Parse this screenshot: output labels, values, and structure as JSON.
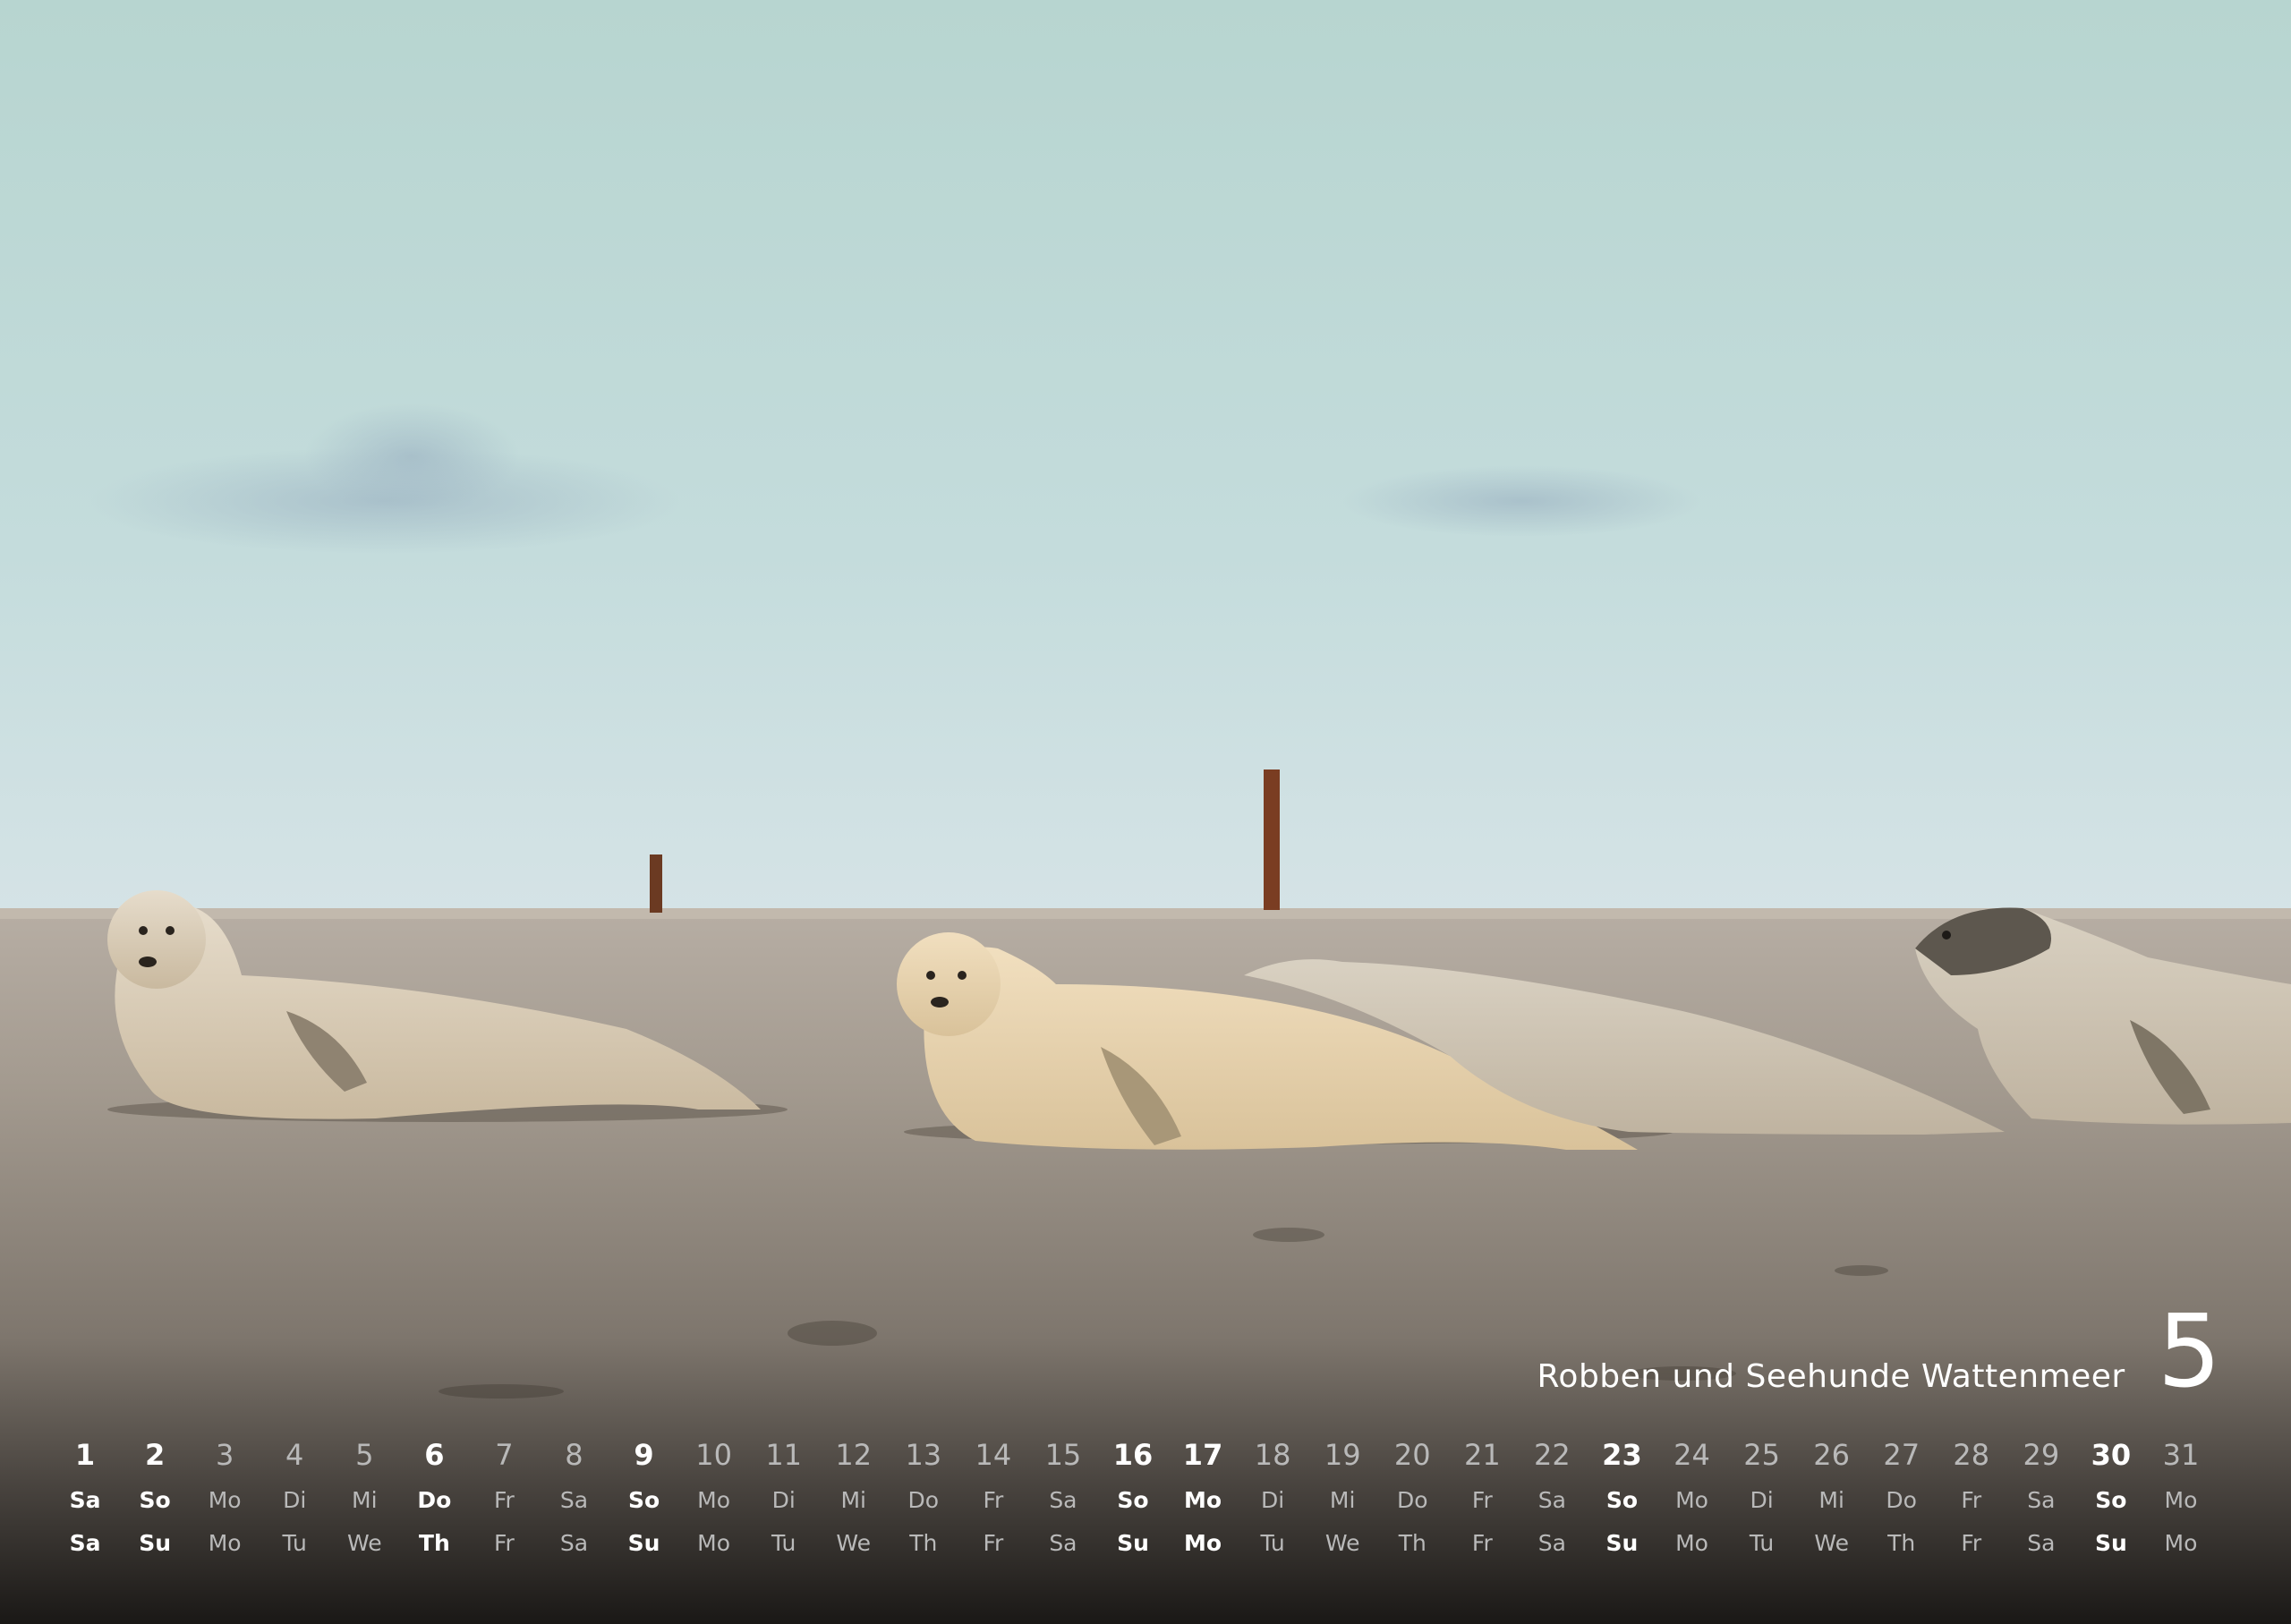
{
  "calendar": {
    "title": "Robben und Seehunde Wattenmeer",
    "month": "5",
    "days": [
      "1",
      "2",
      "3",
      "4",
      "5",
      "6",
      "7",
      "8",
      "9",
      "10",
      "11",
      "12",
      "13",
      "14",
      "15",
      "16",
      "17",
      "18",
      "19",
      "20",
      "21",
      "22",
      "23",
      "24",
      "25",
      "26",
      "27",
      "28",
      "29",
      "30",
      "31"
    ],
    "weekdays_de": [
      "Sa",
      "So",
      "Mo",
      "Di",
      "Mi",
      "Do",
      "Fr",
      "Sa",
      "So",
      "Mo",
      "Di",
      "Mi",
      "Do",
      "Fr",
      "Sa",
      "So",
      "Mo",
      "Di",
      "Mi",
      "Do",
      "Fr",
      "Sa",
      "So",
      "Mo",
      "Di",
      "Mi",
      "Do",
      "Fr",
      "Sa",
      "So",
      "Mo"
    ],
    "weekdays_en": [
      "Sa",
      "Su",
      "Mo",
      "Tu",
      "We",
      "Th",
      "Fr",
      "Sa",
      "Su",
      "Mo",
      "Tu",
      "We",
      "Th",
      "Fr",
      "Sa",
      "Su",
      "Mo",
      "Tu",
      "We",
      "Th",
      "Fr",
      "Sa",
      "Su",
      "Mo",
      "Tu",
      "We",
      "Th",
      "Fr",
      "Sa",
      "Su",
      "Mo"
    ],
    "highlighted_days": [
      1,
      2,
      6,
      9,
      16,
      17,
      23,
      30
    ]
  },
  "colors": {
    "sky_top": "#b9d6d2",
    "sky_bottom": "#cfe0e2",
    "sand": "#9a8f83",
    "text": "#ffffff",
    "text_muted": "#b9b9b9"
  }
}
